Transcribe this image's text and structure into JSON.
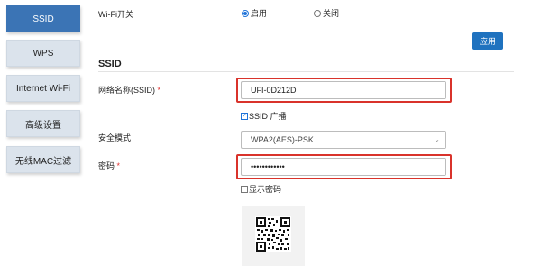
{
  "sidebar": {
    "items": [
      {
        "label": "SSID",
        "active": true
      },
      {
        "label": "WPS",
        "active": false
      },
      {
        "label": "Internet Wi-Fi",
        "active": false
      },
      {
        "label": "高级设置",
        "active": false
      },
      {
        "label": "无线MAC过滤",
        "active": false
      }
    ]
  },
  "wifi_switch": {
    "label": "Wi-Fi开关",
    "options": [
      {
        "label": "启用",
        "selected": true
      },
      {
        "label": "关闭",
        "selected": false
      }
    ]
  },
  "apply_button": {
    "label": "应用"
  },
  "section_title": "SSID",
  "ssid_field": {
    "label": "网络名称(SSID)",
    "required_mark": "*",
    "value": "UFI-0D212D"
  },
  "broadcast_checkbox": {
    "label": "SSID 广播",
    "checked": true
  },
  "security_mode": {
    "label": "安全模式",
    "value": "WPA2(AES)-PSK"
  },
  "password_field": {
    "label": "密码",
    "required_mark": "*",
    "value": "••••••••••••"
  },
  "show_password_checkbox": {
    "label": "显示密码",
    "checked": false
  },
  "qr_code": {
    "icon": "qr-code"
  },
  "colors": {
    "accent": "#1f72bf",
    "highlight": "#d9332b",
    "sidebar_active": "#3b74b5",
    "sidebar_item": "#dbe3ec"
  }
}
